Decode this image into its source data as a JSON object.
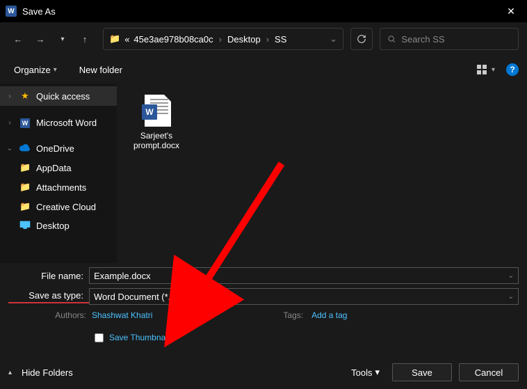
{
  "window": {
    "title": "Save As"
  },
  "nav": {
    "crumbs": [
      "45e3ae978b08ca0c",
      "Desktop",
      "SS"
    ],
    "prefix": "«"
  },
  "search": {
    "placeholder": "Search SS"
  },
  "toolbar": {
    "organize": "Organize",
    "new_folder": "New folder"
  },
  "sidebar": {
    "items": [
      {
        "label": "Quick access",
        "icon": "star",
        "expandable": true,
        "selected": true,
        "indent": false
      },
      {
        "label": "Microsoft Word",
        "icon": "word",
        "expandable": true,
        "selected": false,
        "indent": false
      },
      {
        "label": "OneDrive",
        "icon": "cloud",
        "expandable": true,
        "expanded": true,
        "selected": false,
        "indent": false
      },
      {
        "label": "AppData",
        "icon": "folder",
        "expandable": false,
        "selected": false,
        "indent": true
      },
      {
        "label": "Attachments",
        "icon": "folder",
        "expandable": false,
        "selected": false,
        "indent": true
      },
      {
        "label": "Creative Cloud",
        "icon": "folder",
        "expandable": false,
        "selected": false,
        "indent": true
      },
      {
        "label": "Desktop",
        "icon": "desktop",
        "expandable": false,
        "selected": false,
        "indent": true
      }
    ]
  },
  "files": [
    {
      "name": "Sarjeet's prompt.docx"
    }
  ],
  "form": {
    "filename_label": "File name:",
    "filename_value": "Example.docx",
    "type_label": "Save as type:",
    "type_value": "Word Document (*.docx)",
    "authors_label": "Authors:",
    "authors_value": "Shashwat Khatri",
    "tags_label": "Tags:",
    "tags_value": "Add a tag",
    "thumbnail_label": "Save Thumbnail"
  },
  "footer": {
    "hide_folders": "Hide Folders",
    "tools": "Tools",
    "save": "Save",
    "cancel": "Cancel"
  }
}
